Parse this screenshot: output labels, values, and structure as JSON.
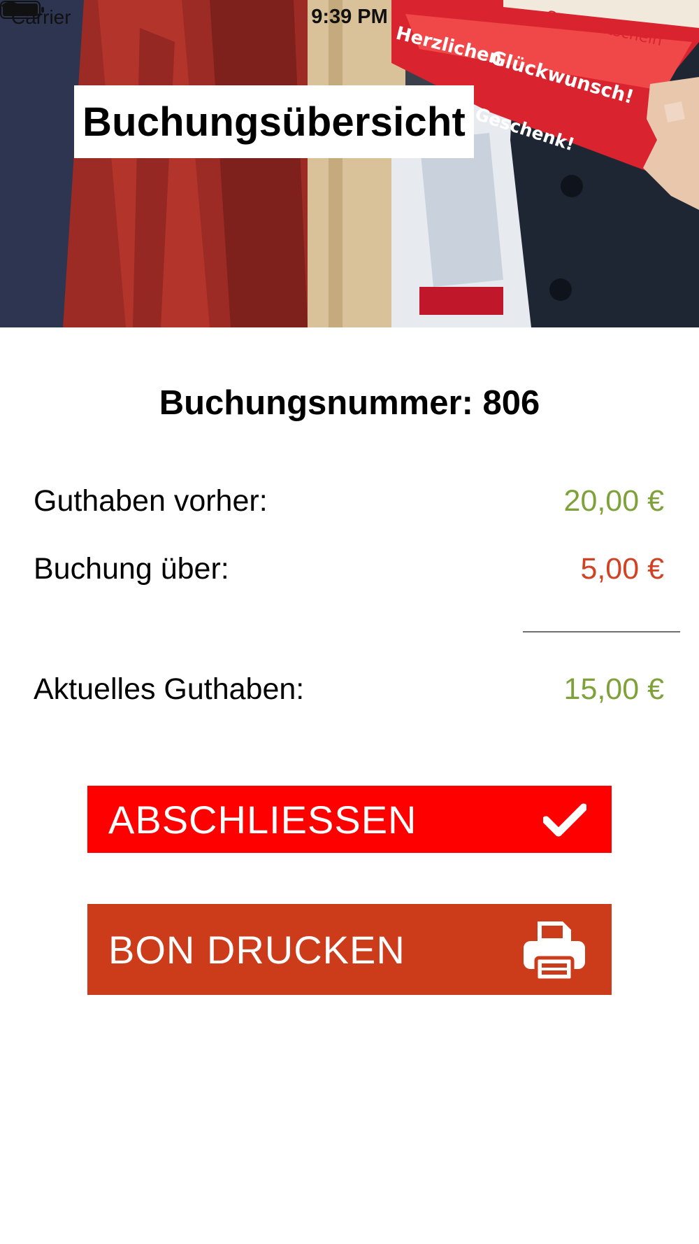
{
  "status_bar": {
    "carrier": "Carrier",
    "time": "9:39 PM",
    "icons": [
      "wifi-icon",
      "battery-icon"
    ]
  },
  "header": {
    "title": "Buchungsübersicht",
    "image_card_texts": [
      "Herzlichen",
      "Glückwunsch!",
      "Geschenk!",
      "StadtGutschein"
    ]
  },
  "booking": {
    "number_label": "Buchungsnummer:",
    "number_value": "806"
  },
  "summary": {
    "previous_label": "Guthaben vorher:",
    "previous_amount": "20,00 €",
    "booking_label": "Buchung über:",
    "booking_amount": "5,00 €",
    "current_label": "Aktuelles Guthaben:",
    "current_amount": "15,00 €"
  },
  "actions": {
    "finish_label": "ABSCHLIESSEN",
    "finish_icon": "checkmark-icon",
    "print_label": "BON DRUCKEN",
    "print_icon": "printer-icon"
  },
  "colors": {
    "positive": "#7ea13a",
    "negative": "#d14224",
    "finish_button": "#ff0000",
    "print_button": "#cc3b1a"
  }
}
